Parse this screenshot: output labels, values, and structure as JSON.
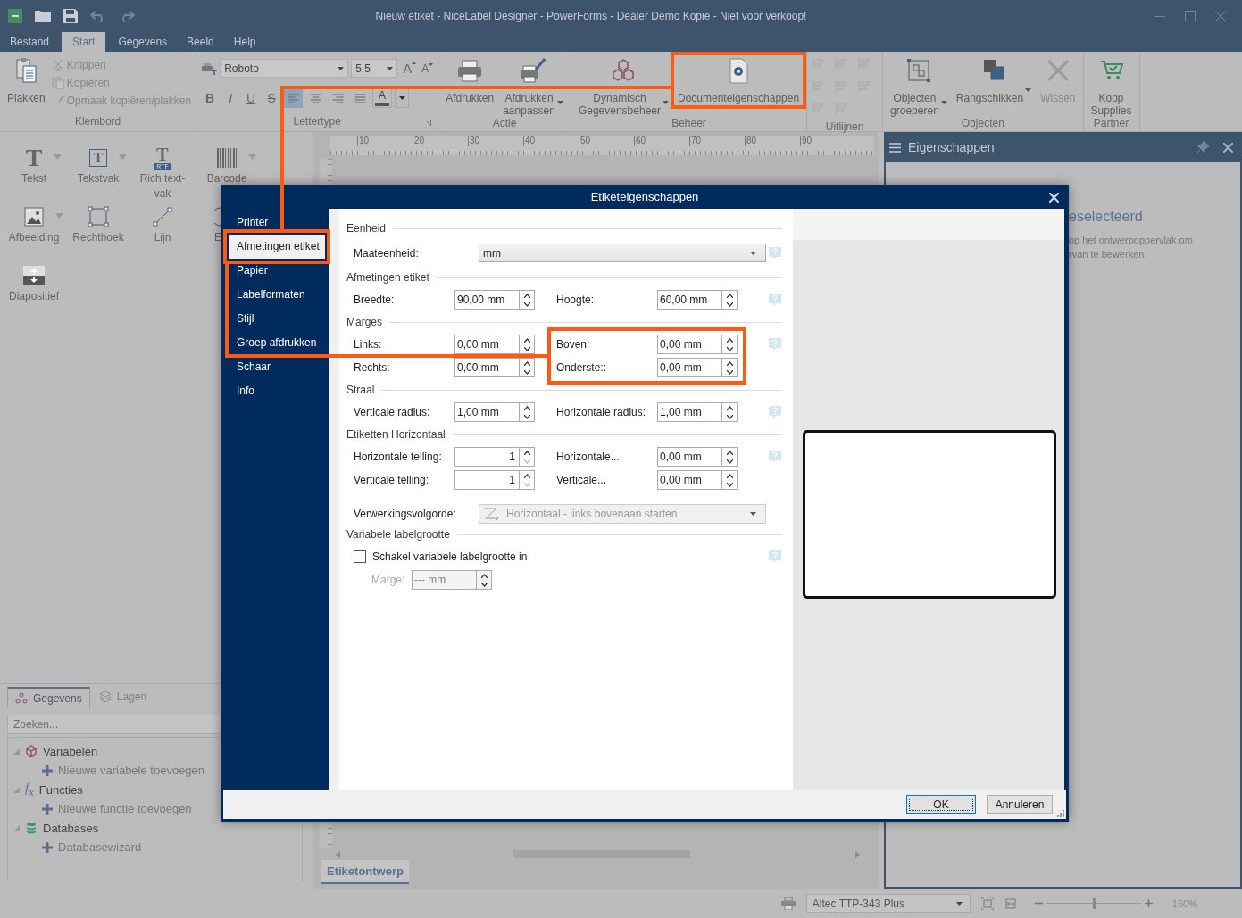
{
  "window": {
    "title": "Nieuw etiket - NiceLabel Designer - PowerForms - Dealer Demo Kopie - Niet voor verkoop!"
  },
  "menu_tabs": [
    {
      "label": "Bestand",
      "selected": false
    },
    {
      "label": "Start",
      "selected": true
    },
    {
      "label": "Gegevens",
      "selected": false
    },
    {
      "label": "Beeld",
      "selected": false
    },
    {
      "label": "Help",
      "selected": false
    }
  ],
  "ribbon": [
    {
      "title": "Klembord",
      "kind": "buttons",
      "items": [
        {
          "label": "Plakken",
          "kind": "large",
          "disabled": false,
          "dropdown": false
        },
        {
          "label": "Knippen",
          "kind": "small",
          "disabled": true,
          "dropdown": false
        },
        {
          "label": "Kopiëren",
          "kind": "small",
          "disabled": true,
          "dropdown": false
        },
        {
          "label": "Opmaak kopiëren/plakken",
          "kind": "small",
          "disabled": true,
          "dropdown": false
        }
      ]
    },
    {
      "title": "Lettertype",
      "kind": "font",
      "font": "Roboto",
      "size": "5,5",
      "size_buttons": [
        "A",
        "A"
      ],
      "format_buttons": [
        "B",
        "I",
        "U",
        "S"
      ],
      "align_buttons": [
        {
          "selected": true
        },
        {
          "selected": false
        },
        {
          "selected": false
        },
        {
          "selected": false
        }
      ],
      "color_button": "A"
    },
    {
      "title": "Actie",
      "kind": "buttons",
      "items": [
        {
          "label": "Afdrukken",
          "kind": "large",
          "disabled": false,
          "dropdown": false
        },
        {
          "label": "Afdrukken aanpassen",
          "kind": "large",
          "disabled": false,
          "dropdown": true
        }
      ]
    },
    {
      "title": "Beheer",
      "kind": "buttons",
      "items": [
        {
          "label": "Dynamisch Gegevensbeheer",
          "kind": "large",
          "disabled": false,
          "dropdown": true
        },
        {
          "label": "Documenteigenschappen",
          "kind": "large",
          "disabled": false,
          "dropdown": false
        }
      ]
    },
    {
      "title": "Uitlijnen",
      "kind": "align-grid"
    },
    {
      "title": "Objecten",
      "kind": "buttons",
      "items": [
        {
          "label": "Objecten groeperen",
          "kind": "large",
          "disabled": false,
          "dropdown": true
        },
        {
          "label": "Rangschikken",
          "kind": "large",
          "disabled": false,
          "dropdown": true
        },
        {
          "label": "Wissen",
          "kind": "large",
          "disabled": true,
          "dropdown": false
        }
      ]
    },
    {
      "title": "Partner",
      "kind": "buttons",
      "items": [
        {
          "label": "Koop Supplies",
          "kind": "large",
          "disabled": false,
          "dropdown": false
        }
      ]
    }
  ],
  "toolbox": [
    {
      "label": "Tekst",
      "glyph": "T",
      "dropdown": true
    },
    {
      "label": "Tekstvak",
      "glyph": "T",
      "dropdown": true
    },
    {
      "label": "Rich text-vak",
      "glyph": "T",
      "badge": "RTF",
      "dropdown": false
    },
    {
      "label": "Barcode",
      "dropdown": true
    },
    {
      "label": "Afbeelding",
      "dropdown": true
    },
    {
      "label": "Rechthoek",
      "dropdown": false
    },
    {
      "label": "Lijn",
      "dropdown": false
    },
    {
      "label": "E"
    },
    {
      "label": "Diapositief",
      "dropdown": false
    }
  ],
  "data_panel": {
    "tabs": [
      {
        "label": "Gegevens",
        "selected": true
      },
      {
        "label": "Lagen",
        "selected": false
      }
    ],
    "search": {
      "placeholder": "Zoeken..."
    },
    "tree": [
      {
        "label": "Variabelen",
        "expanded": true,
        "children": [
          {
            "label": "Nieuwe variabele toevoegen"
          }
        ]
      },
      {
        "label": "Functies",
        "glyph": "f$_{x}$",
        "expanded": true,
        "children": [
          {
            "label": "Nieuwe functie toevoegen"
          }
        ]
      },
      {
        "label": "Databases",
        "expanded": true,
        "children": [
          {
            "label": "Databasewizard"
          }
        ]
      }
    ]
  },
  "canvas": {
    "ruler_marks": [
      "10",
      "20",
      "30",
      "40",
      "50",
      "60",
      "70",
      "80",
      "90"
    ],
    "tabs": [
      {
        "label": "Etiketontwerp",
        "selected": true
      }
    ]
  },
  "properties_panel": {
    "title": "Eigenschappen",
    "heading": "eselecteerd",
    "text": [
      "op het ontwerpoppervlak om",
      "rvan te bewerken."
    ]
  },
  "status_bar": {
    "printer": "Altec TTP-343 Plus",
    "zoom": {
      "level": 0.5
    },
    "zoom_text": "160%"
  },
  "dialog": {
    "title": "Etiketeigenschappen",
    "nav": [
      {
        "label": "Printer",
        "selected": false
      },
      {
        "label": "Afmetingen etiket",
        "selected": true
      },
      {
        "label": "Papier",
        "selected": false
      },
      {
        "label": "Labelformaten",
        "selected": false
      },
      {
        "label": "Stijl",
        "selected": false
      },
      {
        "label": "Groep afdrukken",
        "selected": false
      },
      {
        "label": "Schaar",
        "selected": false
      },
      {
        "label": "Info",
        "selected": false
      }
    ],
    "sections": [
      {
        "title": "Eenheid",
        "rows": [
          {
            "kind": "main",
            "help": true,
            "fields": [
              {
                "kind": "dropdown",
                "label": "Maateenheid:",
                "value": "mm",
                "disabled": false
              }
            ]
          }
        ]
      },
      {
        "title": "Afmetingen etiket",
        "rows": [
          {
            "kind": "main",
            "help": true,
            "fields": [
              {
                "kind": "spin",
                "label": "Breedte:",
                "value": "90,00 mm",
                "disabled": false
              },
              {
                "kind": "spin",
                "label": "Hoogte:",
                "value": "60,00 mm",
                "disabled": false
              }
            ]
          }
        ]
      },
      {
        "title": "Marges",
        "rows": [
          {
            "kind": "main",
            "help": true,
            "fields": [
              {
                "kind": "spin",
                "label": "Links:",
                "value": "0,00 mm",
                "disabled": false
              },
              {
                "kind": "spin",
                "label": "Boven:",
                "value": "0,00 mm",
                "disabled": false
              }
            ]
          },
          {
            "kind": "main",
            "help": false,
            "fields": [
              {
                "kind": "spin",
                "label": "Rechts:",
                "value": "0,00 mm",
                "disabled": false
              },
              {
                "kind": "spin",
                "label": "Onderste::",
                "value": "0,00 mm",
                "disabled": false
              }
            ]
          }
        ]
      },
      {
        "title": "Straal",
        "rows": [
          {
            "kind": "main",
            "help": true,
            "fields": [
              {
                "kind": "spin",
                "label": "Verticale radius:",
                "value": "1,00 mm",
                "disabled": false
              },
              {
                "kind": "spin",
                "label": "Horizontale radius:",
                "value": "1,00 mm",
                "disabled": false
              }
            ]
          }
        ]
      },
      {
        "title": "Etiketten Horizontaal",
        "rows": [
          {
            "kind": "main",
            "help": true,
            "fields": [
              {
                "kind": "count",
                "label": "Horizontale telling:",
                "value": "1",
                "disabled": false
              },
              {
                "kind": "spin",
                "label": "Horizontale...",
                "value": "0,00 mm",
                "disabled": false
              }
            ]
          },
          {
            "kind": "main",
            "help": false,
            "fields": [
              {
                "kind": "count",
                "label": "Verticale telling:",
                "value": "1",
                "disabled": false
              },
              {
                "kind": "spin",
                "label": "Verticale...",
                "value": "0,00 mm",
                "disabled": false
              }
            ]
          },
          {
            "kind": "spaced",
            "help": false,
            "fields": [
              {
                "kind": "order",
                "label": "Verwerkingsvolgorde:",
                "value": "Horizontaal - links bovenaan starten",
                "disabled": true
              }
            ]
          }
        ]
      },
      {
        "title": "Variabele labelgrootte",
        "rows": [
          {
            "kind": "main",
            "help": true,
            "fields": [
              {
                "kind": "checkbox",
                "label": "Schakel variabele labelgrootte in",
                "checked": false
              }
            ]
          },
          {
            "kind": "sub",
            "help": false,
            "fields": [
              {
                "kind": "spin",
                "label": "Marge:",
                "value": "--- mm",
                "disabled": true
              }
            ]
          }
        ]
      }
    ],
    "buttons": [
      {
        "label": "OK",
        "default": true
      },
      {
        "label": "Annuleren",
        "default": false
      }
    ]
  }
}
